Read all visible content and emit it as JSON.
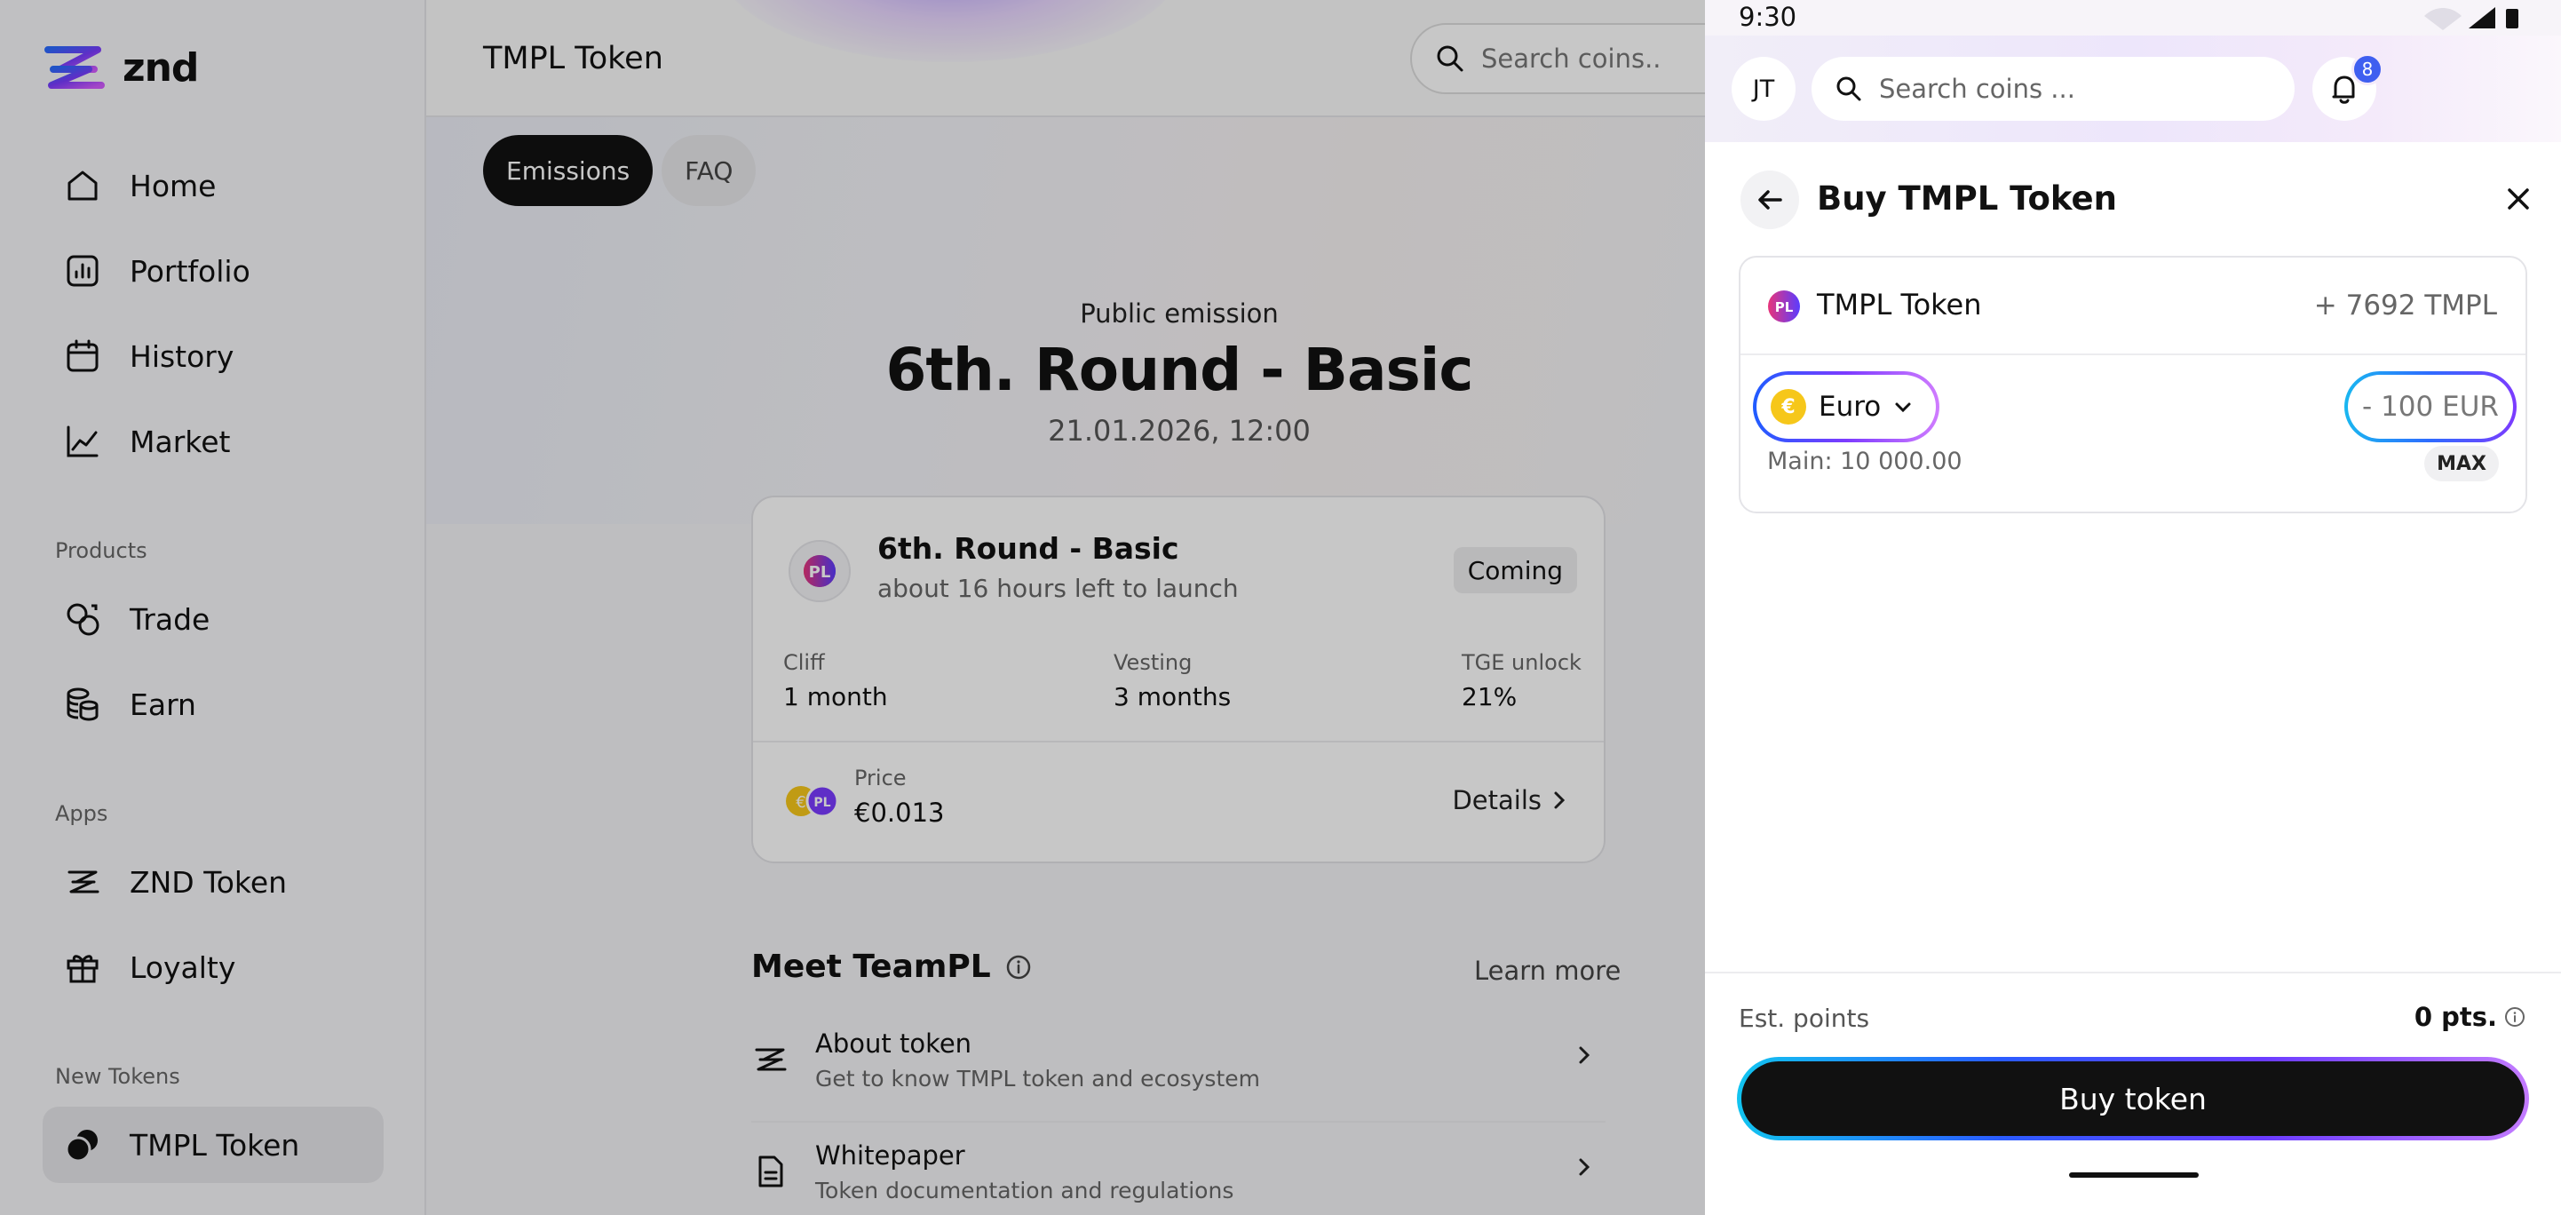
{
  "app": {
    "logo_text": "znd",
    "brand_gradient": [
      "#2a6bff",
      "#7a3cff",
      "#d35bff"
    ]
  },
  "sidebar": {
    "main_items": [
      {
        "label": "Home",
        "icon": "home-icon"
      },
      {
        "label": "Portfolio",
        "icon": "portfolio-icon"
      },
      {
        "label": "History",
        "icon": "calendar-icon"
      },
      {
        "label": "Market",
        "icon": "chart-line-icon"
      }
    ],
    "products_label": "Products",
    "products": [
      {
        "label": "Trade",
        "icon": "trade-icon"
      },
      {
        "label": "Earn",
        "icon": "coins-stack-icon"
      }
    ],
    "apps_label": "Apps",
    "apps": [
      {
        "label": "ZND Token",
        "icon": "znd-logo-icon"
      },
      {
        "label": "Loyalty",
        "icon": "gift-icon"
      }
    ],
    "new_tokens_label": "New Tokens",
    "new_tokens": [
      {
        "label": "TMPL Token",
        "icon": "tmpl-token-icon",
        "active": true
      }
    ]
  },
  "header": {
    "title": "TMPL Token",
    "search_placeholder": "Search coins.."
  },
  "tabs": [
    {
      "label": "Emissions",
      "active": true
    },
    {
      "label": "FAQ",
      "active": false
    }
  ],
  "emission": {
    "kicker": "Public emission",
    "title": "6th. Round - Basic",
    "date": "21.01.2026, 12:00"
  },
  "round_card": {
    "name": "6th. Round - Basic",
    "subtitle": "about 16 hours left to launch",
    "status": "Coming",
    "stats": [
      {
        "label": "Cliff",
        "value": "1 month"
      },
      {
        "label": "Vesting",
        "value": "3 months"
      },
      {
        "label": "TGE unlock",
        "value": "21%"
      }
    ],
    "price_label": "Price",
    "price_value": "€0.013",
    "details_label": "Details"
  },
  "meet": {
    "title": "Meet TeamPL",
    "learn_more": "Learn more",
    "items": [
      {
        "title": "About token",
        "subtitle": "Get to know TMPL token and ecosystem",
        "icon": "znd-logo-icon"
      },
      {
        "title": "Whitepaper",
        "subtitle": "Token documentation and regulations",
        "icon": "document-icon"
      }
    ]
  },
  "phone": {
    "status_time": "9:30",
    "avatar_initials": "JT",
    "search_placeholder": "Search coins ...",
    "notification_count": "8",
    "sheet_title": "Buy TMPL Token",
    "receive_token": "TMPL Token",
    "receive_amount": "+ 7692 TMPL",
    "pay_currency": "Euro",
    "pay_currency_symbol": "€",
    "pay_amount": "- 100 EUR",
    "main_balance": "Main: 10 000.00",
    "max_label": "MAX",
    "est_points_label": "Est. points",
    "est_points_value": "0 pts.",
    "buy_button": "Buy token"
  },
  "colors": {
    "accent_blue": "#3f5ff0",
    "euro_yellow": "#f6c71a",
    "primary_button": "#111111"
  }
}
